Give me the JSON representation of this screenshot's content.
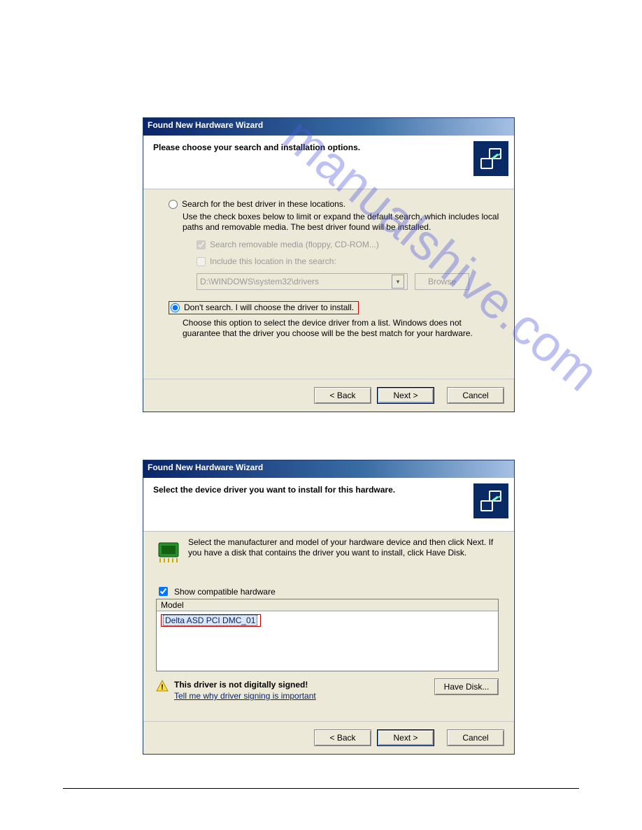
{
  "watermark": "manualshive.com",
  "dialog1": {
    "title": "Found New Hardware Wizard",
    "header": "Please choose your search and installation options.",
    "option_search": "Search for the best driver in these locations.",
    "option_search_desc": "Use the check boxes below to limit or expand the default search, which includes local paths and removable media. The best driver found will be installed.",
    "check_removable": "Search removable media (floppy, CD-ROM...)",
    "check_include": "Include this location in the search:",
    "path_value": "D:\\WINDOWS\\system32\\drivers",
    "browse_label": "Browse",
    "option_dont": "Don't search. I will choose the driver to install.",
    "option_dont_desc": "Choose this option to select the device driver from a list.  Windows does not guarantee that the driver you choose will be the best match for your hardware.",
    "buttons": {
      "back": "< Back",
      "next": "Next >",
      "cancel": "Cancel"
    }
  },
  "dialog2": {
    "title": "Found New Hardware Wizard",
    "header": "Select the device driver you want to install for this hardware.",
    "instruction": "Select the manufacturer and model of your hardware device and then click Next. If you have a disk that contains the driver you want to install, click Have Disk.",
    "show_compat": "Show compatible hardware",
    "model_header": "Model",
    "model_item": "Delta ASD PCI DMC_01",
    "warning_title": "This driver is not digitally signed!",
    "warning_link": "Tell me why driver signing is important",
    "have_disk": "Have Disk...",
    "buttons": {
      "back": "< Back",
      "next": "Next >",
      "cancel": "Cancel"
    }
  }
}
